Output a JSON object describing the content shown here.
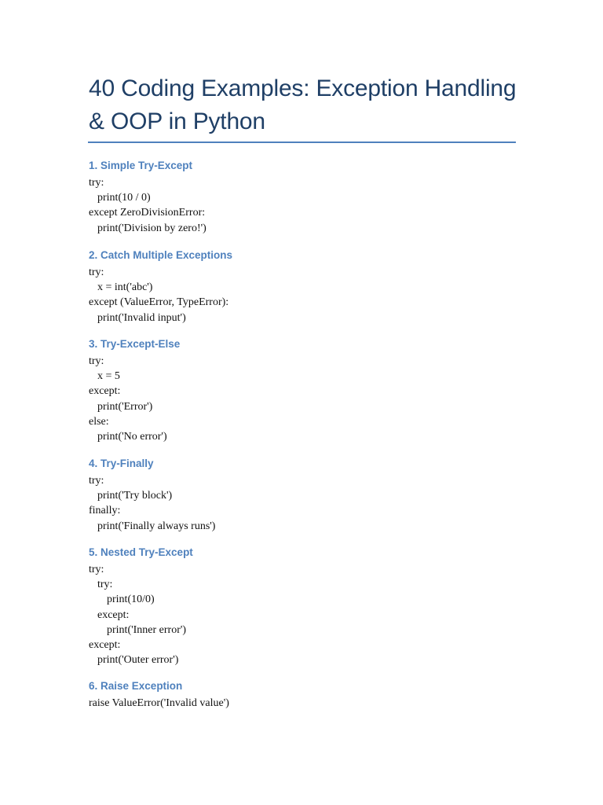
{
  "title": "40 Coding Examples: Exception Handling & OOP in Python",
  "sections": [
    {
      "heading": "1. Simple Try-Except",
      "lines": [
        "try:",
        "print(10 / 0)",
        "except ZeroDivisionError:",
        "print('Division by zero!')"
      ]
    },
    {
      "heading": "2. Catch Multiple Exceptions",
      "lines": [
        "try:",
        "x = int('abc')",
        "except (ValueError, TypeError):",
        "print('Invalid input')"
      ]
    },
    {
      "heading": "3. Try-Except-Else",
      "lines": [
        "try:",
        "x = 5",
        "except:",
        "print('Error')",
        "else:",
        "print('No error')"
      ]
    },
    {
      "heading": "4. Try-Finally",
      "lines": [
        "try:",
        "print('Try block')",
        "finally:",
        "print('Finally always runs')"
      ]
    },
    {
      "heading": "5. Nested Try-Except",
      "lines": [
        "try:",
        "try:",
        "print(10/0)",
        "except:",
        "print('Inner error')",
        "except:",
        "print('Outer error')"
      ]
    },
    {
      "heading": "6. Raise Exception",
      "lines": [
        "raise ValueError('Invalid value')"
      ]
    }
  ]
}
